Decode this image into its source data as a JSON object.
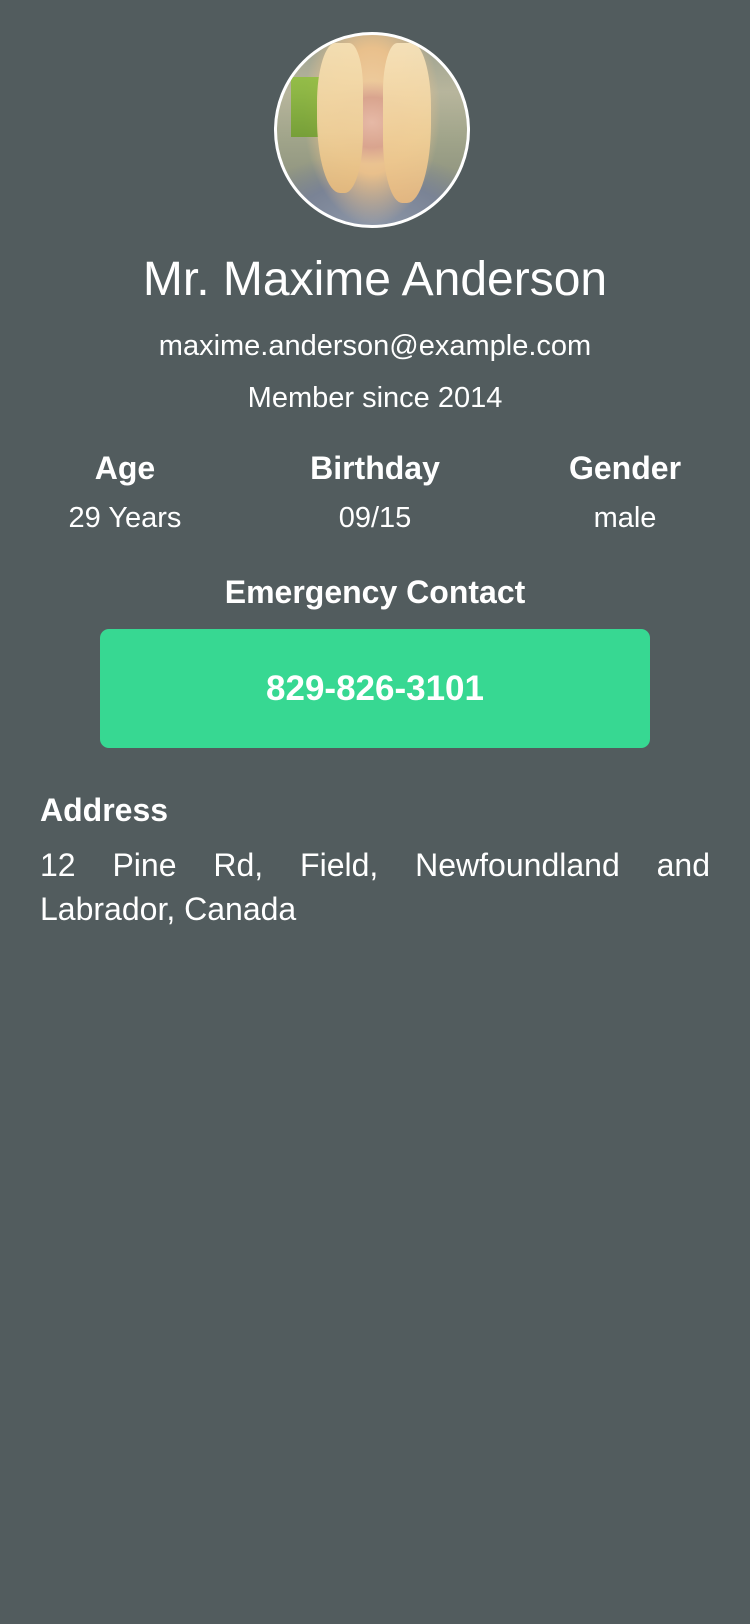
{
  "profile": {
    "avatar_icon": "user-photo",
    "name": "Mr. Maxime Anderson",
    "email": "maxime.anderson@example.com",
    "member_since": "Member since 2014"
  },
  "stats": [
    {
      "label": "Age",
      "value": "29 Years"
    },
    {
      "label": "Birthday",
      "value": "09/15"
    },
    {
      "label": "Gender",
      "value": "male"
    }
  ],
  "emergency": {
    "title": "Emergency Contact",
    "phone": "829-826-3101"
  },
  "address": {
    "label": "Address",
    "text": "12 Pine Rd, Field, Newfoundland and Labrador, Canada"
  },
  "colors": {
    "background": "#525c5e",
    "accent": "#37d892",
    "text": "#ffffff"
  }
}
